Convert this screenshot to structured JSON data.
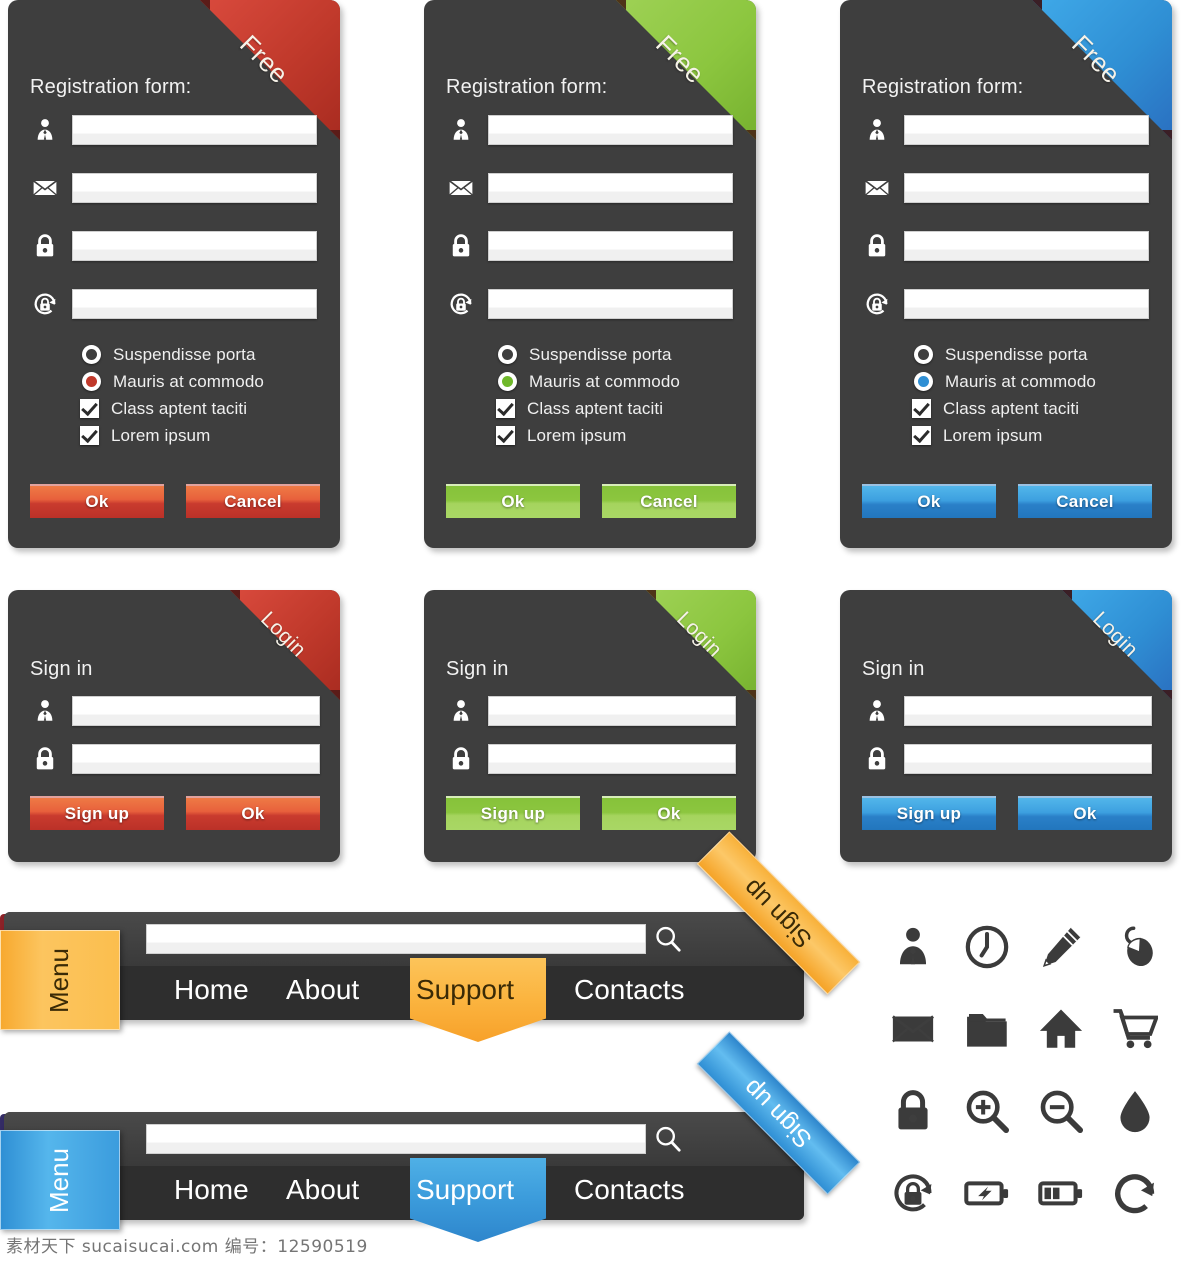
{
  "palette": {
    "card_bg": "#3e3e3e",
    "red": "#c0392b",
    "red_light": "#e8603c",
    "red_dark": "#b5302a",
    "green": "#8cc63f",
    "green_light": "#9fd356",
    "green_dark": "#79b52e",
    "blue": "#2f8fd4",
    "blue_light": "#4db0e8",
    "blue_dark": "#1f74b8",
    "orange": "#f2a93b",
    "orange_light": "#fcc55f",
    "orange_dark": "#f08a1c"
  },
  "registration_cards": [
    {
      "theme": "red",
      "ribbon_label": "Free",
      "title": "Registration form:",
      "fields": [
        {
          "icon": "user-icon",
          "value": "",
          "placeholder": ""
        },
        {
          "icon": "envelope-icon",
          "value": "",
          "placeholder": ""
        },
        {
          "icon": "lock-icon",
          "value": "",
          "placeholder": ""
        },
        {
          "icon": "lock-refresh-icon",
          "value": "",
          "placeholder": ""
        }
      ],
      "options": [
        {
          "type": "radio",
          "label": "Suspendisse porta",
          "checked": false
        },
        {
          "type": "radio",
          "label": "Mauris at commodo",
          "checked": true
        },
        {
          "type": "checkbox",
          "label": "Class aptent taciti",
          "checked": true
        },
        {
          "type": "checkbox",
          "label": "Lorem ipsum",
          "checked": true
        }
      ],
      "buttons": [
        "Ok",
        "Cancel"
      ]
    },
    {
      "theme": "green",
      "ribbon_label": "Free",
      "title": "Registration form:",
      "fields": [
        {
          "icon": "user-icon",
          "value": "",
          "placeholder": ""
        },
        {
          "icon": "envelope-icon",
          "value": "",
          "placeholder": ""
        },
        {
          "icon": "lock-icon",
          "value": "",
          "placeholder": ""
        },
        {
          "icon": "lock-refresh-icon",
          "value": "",
          "placeholder": ""
        }
      ],
      "options": [
        {
          "type": "radio",
          "label": "Suspendisse porta",
          "checked": false
        },
        {
          "type": "radio",
          "label": "Mauris at commodo",
          "checked": true
        },
        {
          "type": "checkbox",
          "label": "Class aptent taciti",
          "checked": true
        },
        {
          "type": "checkbox",
          "label": "Lorem ipsum",
          "checked": true
        }
      ],
      "buttons": [
        "Ok",
        "Cancel"
      ]
    },
    {
      "theme": "blue",
      "ribbon_label": "Free",
      "title": "Registration form:",
      "fields": [
        {
          "icon": "user-icon",
          "value": "",
          "placeholder": ""
        },
        {
          "icon": "envelope-icon",
          "value": "",
          "placeholder": ""
        },
        {
          "icon": "lock-icon",
          "value": "",
          "placeholder": ""
        },
        {
          "icon": "lock-refresh-icon",
          "value": "",
          "placeholder": ""
        }
      ],
      "options": [
        {
          "type": "radio",
          "label": "Suspendisse porta",
          "checked": false
        },
        {
          "type": "radio",
          "label": "Mauris at commodo",
          "checked": true
        },
        {
          "type": "checkbox",
          "label": "Class aptent taciti",
          "checked": true
        },
        {
          "type": "checkbox",
          "label": "Lorem ipsum",
          "checked": true
        }
      ],
      "buttons": [
        "Ok",
        "Cancel"
      ]
    }
  ],
  "signin_cards": [
    {
      "theme": "red",
      "ribbon_label": "Login",
      "title": "Sign in",
      "fields": [
        {
          "icon": "user-icon",
          "value": ""
        },
        {
          "icon": "lock-icon",
          "value": ""
        }
      ],
      "buttons": [
        "Sign up",
        "Ok"
      ]
    },
    {
      "theme": "green",
      "ribbon_label": "Login",
      "title": "Sign in",
      "fields": [
        {
          "icon": "user-icon",
          "value": ""
        },
        {
          "icon": "lock-icon",
          "value": ""
        }
      ],
      "buttons": [
        "Sign up",
        "Ok"
      ]
    },
    {
      "theme": "blue",
      "ribbon_label": "Login",
      "title": "Sign in",
      "fields": [
        {
          "icon": "user-icon",
          "value": ""
        },
        {
          "icon": "lock-icon",
          "value": ""
        }
      ],
      "buttons": [
        "Sign up",
        "Ok"
      ]
    }
  ],
  "menubars": [
    {
      "theme": "orange",
      "menu_tab_label": "Menu",
      "banner_label": "Sign up",
      "search_value": "",
      "search_placeholder": "",
      "search_icon": "magnifier-icon",
      "nav": [
        {
          "label": "Home",
          "active": false
        },
        {
          "label": "About",
          "active": false
        },
        {
          "label": "Support",
          "active": true
        },
        {
          "label": "Contacts",
          "active": false
        }
      ]
    },
    {
      "theme": "blue",
      "menu_tab_label": "Menu",
      "banner_label": "Sign up",
      "search_value": "",
      "search_placeholder": "",
      "search_icon": "magnifier-icon",
      "nav": [
        {
          "label": "Home",
          "active": false
        },
        {
          "label": "About",
          "active": false
        },
        {
          "label": "Support",
          "active": true
        },
        {
          "label": "Contacts",
          "active": false
        }
      ]
    }
  ],
  "icon_grid": [
    "user-icon",
    "clock-icon",
    "pencil-icon",
    "mouse-icon",
    "envelope-icon",
    "folder-icon",
    "home-icon",
    "cart-icon",
    "lock-icon",
    "zoom-in-icon",
    "zoom-out-icon",
    "droplet-icon",
    "lock-refresh-icon",
    "battery-charging-icon",
    "battery-half-icon",
    "refresh-icon"
  ],
  "watermark": "素材天下 sucaisucai.com  编号：12590519"
}
